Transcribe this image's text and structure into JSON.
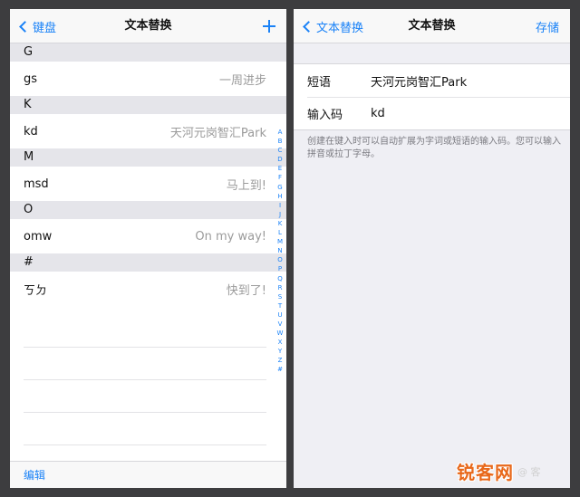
{
  "left": {
    "back_label": "键盘",
    "title": "文本替换",
    "sections": [
      {
        "letter": "G",
        "rows": [
          {
            "short": "gs",
            "phrase": "一周进步"
          }
        ]
      },
      {
        "letter": "K",
        "rows": [
          {
            "short": "kd",
            "phrase": "天河元岗智汇Park"
          }
        ]
      },
      {
        "letter": "M",
        "rows": [
          {
            "short": "msd",
            "phrase": "马上到!"
          }
        ]
      },
      {
        "letter": "O",
        "rows": [
          {
            "short": "omw",
            "phrase": "On my way!"
          }
        ]
      },
      {
        "letter": "#",
        "rows": [
          {
            "short": "ㄎㄉ",
            "phrase": "快到了!"
          }
        ]
      }
    ],
    "index": [
      "A",
      "B",
      "C",
      "D",
      "E",
      "F",
      "G",
      "H",
      "I",
      "J",
      "K",
      "L",
      "M",
      "N",
      "O",
      "P",
      "Q",
      "R",
      "S",
      "T",
      "U",
      "V",
      "W",
      "X",
      "Y",
      "Z",
      "#"
    ],
    "edit_label": "编辑"
  },
  "right": {
    "back_label": "文本替换",
    "title": "文本替换",
    "save_label": "存储",
    "phrase_label": "短语",
    "phrase_value": "天河元岗智汇Park",
    "shortcut_label": "输入码",
    "shortcut_value": "kd",
    "hint": "创建在键入时可以自动扩展为字词或短语的输入码。您可以输入拼音或拉丁字母。"
  },
  "watermark": {
    "main": "锐客网",
    "sub": "@ 客"
  },
  "colors": {
    "accent": "#1a82f7",
    "section_bg": "#e5e5ea",
    "form_bg": "#efeff4",
    "watermark": "#e8681a"
  }
}
